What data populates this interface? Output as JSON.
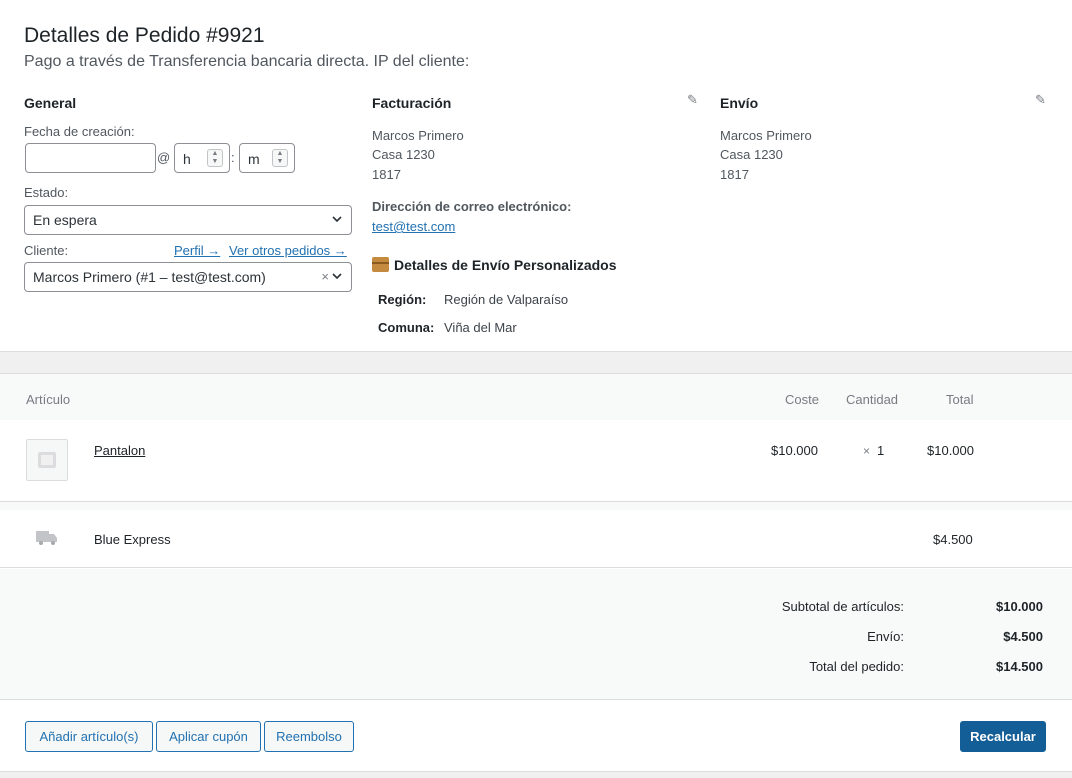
{
  "order": {
    "title": "Detalles de Pedido #9921",
    "subtitle": "Pago a través de Transferencia bancaria directa. IP del cliente:"
  },
  "general": {
    "heading": "General",
    "date_label": "Fecha de creación:",
    "date_value": "",
    "at": "@",
    "colon": ":",
    "hour_placeholder": "h",
    "minute_placeholder": "m",
    "status_label": "Estado:",
    "status_value": "En espera",
    "customer_label": "Cliente:",
    "profile_link": "Perfil →",
    "other_orders_link": "Ver otros pedidos →",
    "customer_value": "Marcos Primero (#1 – test@test.com)",
    "clear_symbol": "×"
  },
  "billing": {
    "heading": "Facturación",
    "lines": [
      "Marcos Primero",
      "Casa 1230",
      "1817"
    ],
    "email_label": "Dirección de correo electrónico:",
    "email": "test@test.com"
  },
  "shipping": {
    "heading": "Envío",
    "lines": [
      "Marcos Primero",
      "Casa 1230",
      "1817"
    ]
  },
  "custom_shipping": {
    "title": "Detalles de Envío Personalizados",
    "rows": [
      {
        "key": "Región:",
        "value": "Región de Valparaíso"
      },
      {
        "key": "Comuna:",
        "value": "Viña del Mar"
      }
    ]
  },
  "items": {
    "headers": {
      "item": "Artículo",
      "cost": "Coste",
      "qty": "Cantidad",
      "total": "Total"
    },
    "rows": [
      {
        "name": "Pantalon",
        "cost": "$10.000",
        "qty_prefix": "×",
        "qty": "1",
        "total": "$10.000"
      }
    ],
    "shipping_line": {
      "name": "Blue Express",
      "total": "$4.500"
    }
  },
  "totals": {
    "subtotal_label": "Subtotal de artículos:",
    "subtotal_value": "$10.000",
    "shipping_label": "Envío:",
    "shipping_value": "$4.500",
    "order_total_label": "Total del pedido:",
    "order_total_value": "$14.500"
  },
  "actions": {
    "add_item": "Añadir artículo(s)",
    "apply_coupon": "Aplicar cupón",
    "refund": "Reembolso",
    "recalculate": "Recalcular"
  },
  "icons": {
    "edit": "pencil-icon",
    "product_placeholder": "image-placeholder-icon",
    "shipping": "truck-icon",
    "package": "package-icon",
    "dropdown": "chevron-down-icon",
    "spinner": "spinner-arrows-icon"
  },
  "colors": {
    "link": "#2271b1",
    "primary_button": "#135e96",
    "muted_text": "#50575e"
  }
}
